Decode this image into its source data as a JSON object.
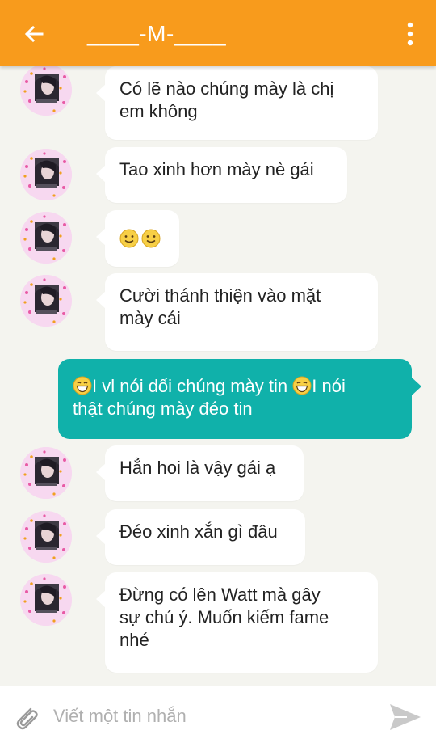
{
  "header": {
    "title": "____-M-____",
    "back_icon": "arrow-left-icon",
    "menu_icon": "more-vertical-icon",
    "background_color": "#f89b1c"
  },
  "messages": [
    {
      "direction": "in",
      "lines": [
        "Có lẽ nào chúng mày là chị",
        "em không"
      ]
    },
    {
      "direction": "in",
      "lines": [
        "Tao xinh hơn mày nè gái"
      ]
    },
    {
      "direction": "in",
      "emoji": [
        "slight-smile-emoji",
        "slight-smile-emoji"
      ]
    },
    {
      "direction": "in",
      "lines": [
        "Cười thánh thiện vào mặt",
        "mày cái"
      ]
    },
    {
      "direction": "out",
      "segments": [
        "I vl nói dối chúng mày tin ",
        "I nói",
        "thật chúng mày đéo tin"
      ],
      "emoji": "grin-emoji"
    },
    {
      "direction": "in",
      "lines": [
        "Hẳn hoi là vậy gái ạ"
      ]
    },
    {
      "direction": "in",
      "lines": [
        "Đéo xinh xắn gì đâu"
      ]
    },
    {
      "direction": "in",
      "lines": [
        "Đừng có lên Watt mà gây",
        "sự chú ý. Muốn kiếm fame",
        "nhé"
      ]
    }
  ],
  "colors": {
    "outgoing_bubble": "#10b1aa",
    "incoming_bubble": "#ffffff",
    "chat_background": "#f4f4ef"
  },
  "composer": {
    "placeholder": "Viết một tin nhắn",
    "attach_icon": "paperclip-icon",
    "send_icon": "send-icon"
  }
}
